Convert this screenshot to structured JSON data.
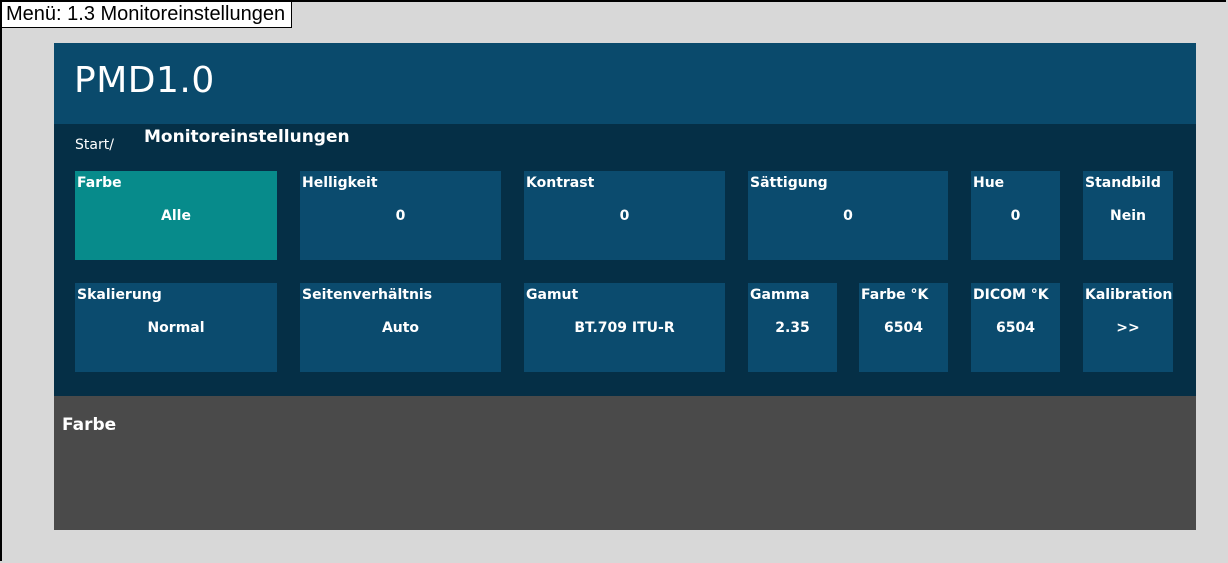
{
  "caption": "Menü: 1.3 Monitoreinstellungen",
  "app": {
    "title": "PMD1.0",
    "breadcrumb": {
      "start": "Start/",
      "current": "Monitoreinstellungen"
    }
  },
  "tiles": [
    {
      "label": "Farbe",
      "value": "Alle",
      "selected": true
    },
    {
      "label": "Helligkeit",
      "value": "0"
    },
    {
      "label": "Kontrast",
      "value": "0"
    },
    {
      "label": "Sättigung",
      "value": "0"
    },
    {
      "label": "Hue",
      "value": "0"
    },
    {
      "label": "Standbild",
      "value": "Nein"
    },
    {
      "label": "Skalierung",
      "value": "Normal"
    },
    {
      "label": "Seitenverhältnis",
      "value": "Auto"
    },
    {
      "label": "Gamut",
      "value": "BT.709 ITU-R"
    },
    {
      "label": "Gamma",
      "value": "2.35"
    },
    {
      "label": "Farbe °K",
      "value": "6504"
    },
    {
      "label": "DICOM °K",
      "value": "6504"
    },
    {
      "label": "Kalibration",
      "value": ">>"
    }
  ],
  "description": {
    "title": "Farbe"
  },
  "colors": {
    "header": "#0a4a6c",
    "panel": "#052f46",
    "tile": "#0b4b6e",
    "tile_selected": "#078b8b",
    "description": "#4a4a4a"
  }
}
